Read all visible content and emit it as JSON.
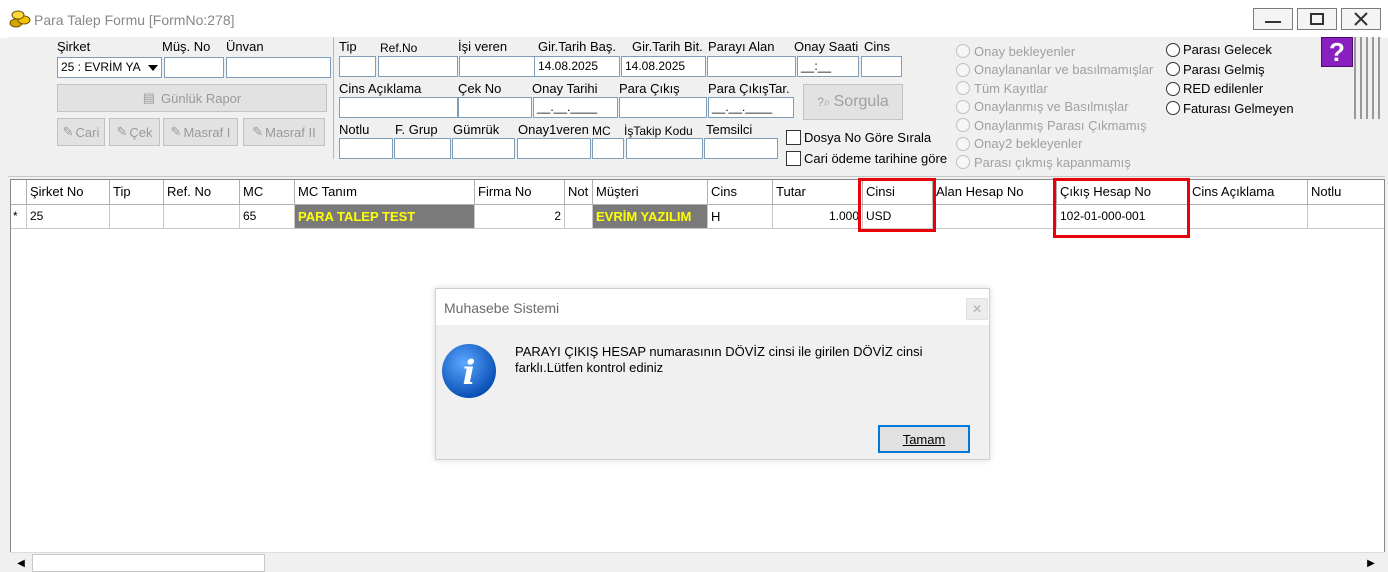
{
  "window": {
    "title": "Para Talep Formu [FormNo:278]",
    "minimize": "—",
    "maximize": "▢",
    "close": "✕"
  },
  "form": {
    "sirket_label": "Şirket",
    "sirket_value": "25 : EVRİM YA",
    "mus_no_label": "Müş. No",
    "unvan_label": "Ünvan",
    "gunluk_rapor": "Günlük Rapor",
    "cari": "Cari",
    "cek": "Çek",
    "masraf1": "Masraf I",
    "masraf2": "Masraf II",
    "tip_label": "Tip",
    "refno_label": "Ref.No",
    "isiveren_label": "İşi veren",
    "gir_bas_label": "Gir.Tarih Baş.",
    "gir_bas_value": "14.08.2025",
    "gir_bit_label": "Gir.Tarih Bit.",
    "gir_bit_value": "14.08.2025",
    "parayi_alan_label": "Parayı Alan",
    "onay_saati_label": "Onay Saati",
    "onay_saati_value": "__:__",
    "cins_label": "Cins",
    "cins_aciklama_label": "Cins Açıklama",
    "cek_no_label": "Çek No",
    "onay_tarihi_label": "Onay Tarihi",
    "onay_tarihi_value": "__.__.____",
    "para_cikis_label": "Para Çıkış",
    "para_cikis_tar_label": "Para ÇıkışTar.",
    "para_cikis_tar_value": "__.__.____",
    "sorgula": "Sorgula",
    "notlu_label": "Notlu",
    "fgrup_label": "F. Grup",
    "gumruk_label": "Gümrük",
    "onay1veren_label": "Onay1veren",
    "mc_label": "MC",
    "istakip_label": "İşTakip Kodu",
    "temsilci_label": "Temsilci",
    "dosya_no_sirala": "Dosya No Göre Sırala",
    "cari_odeme_tarihi": "Cari ödeme tarihine göre"
  },
  "radios_left": [
    "Onay bekleyenler",
    "Onaylananlar ve basılmamışlar",
    "Tüm Kayıtlar",
    "Onaylanmış ve Basılmışlar",
    "Onaylanmış Parası Çıkmamış",
    "Onay2 bekleyenler",
    "Parası çıkmış kapanmamış"
  ],
  "radios_right": [
    "Parası Gelecek",
    "Parası Gelmiş",
    "RED edilenler",
    "Faturası Gelmeyen"
  ],
  "help_icon": "?",
  "grid": {
    "headers": [
      "Şirket No",
      "Tip",
      "Ref. No",
      "MC",
      "MC Tanım",
      "Firma No",
      "Not",
      "Müşteri",
      "Cins",
      "Tutar",
      "Cinsi",
      "Alan Hesap No",
      "Çıkış Hesap No",
      "Cins Açıklama",
      "Notlu"
    ],
    "row": {
      "indicator": "*",
      "sirket_no": "25",
      "tip": "",
      "ref_no": "",
      "mc": "65",
      "mc_tanim": "PARA TALEP TEST",
      "firma_no": "2",
      "not": "",
      "musteri": "EVRİM YAZILIM",
      "cins": "H",
      "tutar": "1.000",
      "cinsi": "USD",
      "alan_hesap_no": "",
      "cikis_hesap_no": "102-01-000-001",
      "cins_aciklama": "",
      "notlu": ""
    }
  },
  "dialog": {
    "title": "Muhasebe Sistemi",
    "close": "✕",
    "message": "PARAYI ÇIKIŞ HESAP numarasının DÖVİZ cinsi ile girilen DÖVİZ cinsi farklı.Lütfen kontrol ediniz",
    "ok_button": "Tamam",
    "icon": "i"
  },
  "scroll": {
    "left": "◀",
    "right": "▶"
  }
}
